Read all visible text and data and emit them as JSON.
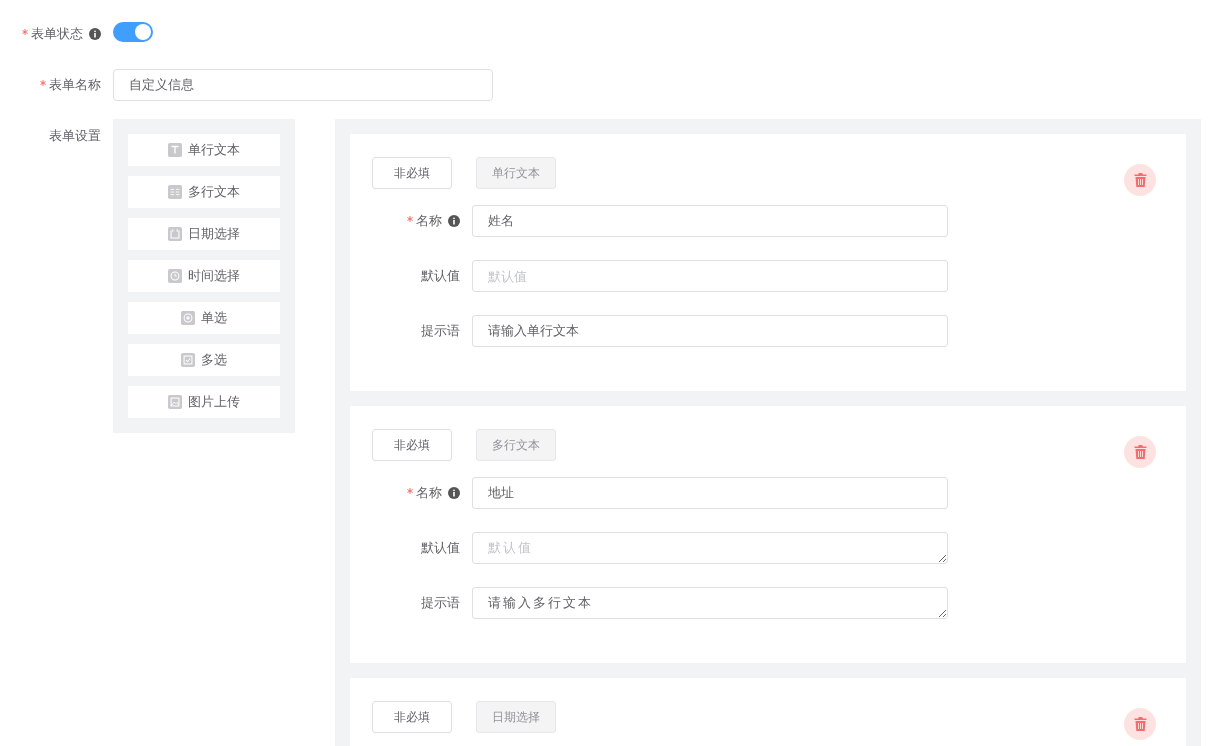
{
  "form_status": {
    "label": "表单状态",
    "required": true,
    "info": true,
    "on": true
  },
  "form_name": {
    "label": "表单名称",
    "required": true,
    "value": "自定义信息"
  },
  "form_settings": {
    "label": "表单设置",
    "palette": [
      {
        "kind": "text",
        "label": "单行文本"
      },
      {
        "kind": "textarea",
        "label": "多行文本"
      },
      {
        "kind": "date",
        "label": "日期选择"
      },
      {
        "kind": "time",
        "label": "时间选择"
      },
      {
        "kind": "radio",
        "label": "单选"
      },
      {
        "kind": "checkbox",
        "label": "多选"
      },
      {
        "kind": "image",
        "label": "图片上传"
      }
    ],
    "cards": [
      {
        "required_button": "非必填",
        "type_button": "单行文本",
        "fields": [
          {
            "kind": "input",
            "label": "名称",
            "required": true,
            "info": true,
            "value": "姓名"
          },
          {
            "kind": "input",
            "label": "默认值",
            "required": false,
            "info": false,
            "placeholder": "默认值"
          },
          {
            "kind": "input",
            "label": "提示语",
            "required": false,
            "info": false,
            "value": "请输入单行文本"
          }
        ]
      },
      {
        "required_button": "非必填",
        "type_button": "多行文本",
        "fields": [
          {
            "kind": "input",
            "label": "名称",
            "required": true,
            "info": true,
            "value": "地址"
          },
          {
            "kind": "textarea",
            "label": "默认值",
            "required": false,
            "info": false,
            "placeholder": "默认值"
          },
          {
            "kind": "textarea",
            "label": "提示语",
            "required": false,
            "info": false,
            "value": "请输入多行文本"
          }
        ]
      },
      {
        "required_button": "非必填",
        "type_button": "日期选择"
      }
    ]
  }
}
